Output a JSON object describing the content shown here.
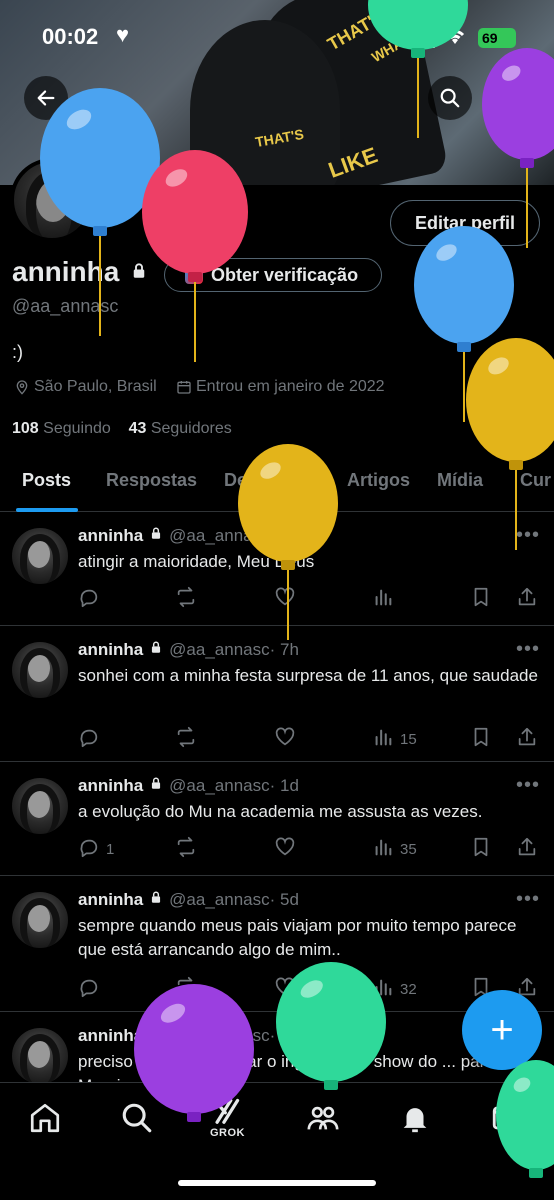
{
  "status_bar": {
    "time": "00:02",
    "battery": "69"
  },
  "profile": {
    "edit_button": "Editar perfil",
    "name": "anninha",
    "verify_button": "Obter verificação",
    "handle": "@aa_annasc",
    "bio": ":)",
    "location": "São Paulo, Brasil",
    "joined": "Entrou em janeiro de 2022",
    "following_count": "108",
    "following_label": "Seguindo",
    "followers_count": "43",
    "followers_label": "Seguidores"
  },
  "tabs": [
    "Posts",
    "Respostas",
    "Destaques",
    "Artigos",
    "Mídia",
    "Cur"
  ],
  "tweets": [
    {
      "name": "anninha",
      "handle": "@aa_annasc",
      "time": "· 20s",
      "text": "atingir a maioridade, Meu Deus",
      "replies": "",
      "views": ""
    },
    {
      "name": "anninha",
      "handle": "@aa_annasc",
      "time": "· 7h",
      "text": "sonhei com a minha festa surpresa de 11 anos, que saudade",
      "replies": "",
      "views": "15"
    },
    {
      "name": "anninha",
      "handle": "@aa_annasc",
      "time": "· 1d",
      "text": "a evolução do Mu na academia me assusta as vezes.",
      "replies": "1",
      "views": "35"
    },
    {
      "name": "anninha",
      "handle": "@aa_annasc",
      "time": "· 5d",
      "text": "sempre quando meus pais viajam por muito tempo parece que está arrancando algo de mim..",
      "replies": "",
      "views": "32"
    },
    {
      "name": "anninha",
      "handle": "@aa_annasc",
      "time": "· 5d",
      "text": "preciso urgente comprar o ingresso do show do ... para o Morning... PPPP",
      "replies": "",
      "views": ""
    }
  ],
  "fab": {
    "icon": "plus-icon",
    "label": "+"
  },
  "bottom_nav": {
    "grok_label": "GROK"
  },
  "banner_text": [
    "THAT'S",
    "WHAT",
    "THAT'S",
    "LIKE"
  ],
  "colors": {
    "accent": "#1d9bf0",
    "background": "#000000",
    "muted": "#71767b",
    "text": "#e7e9ea",
    "border": "#2f3336"
  }
}
